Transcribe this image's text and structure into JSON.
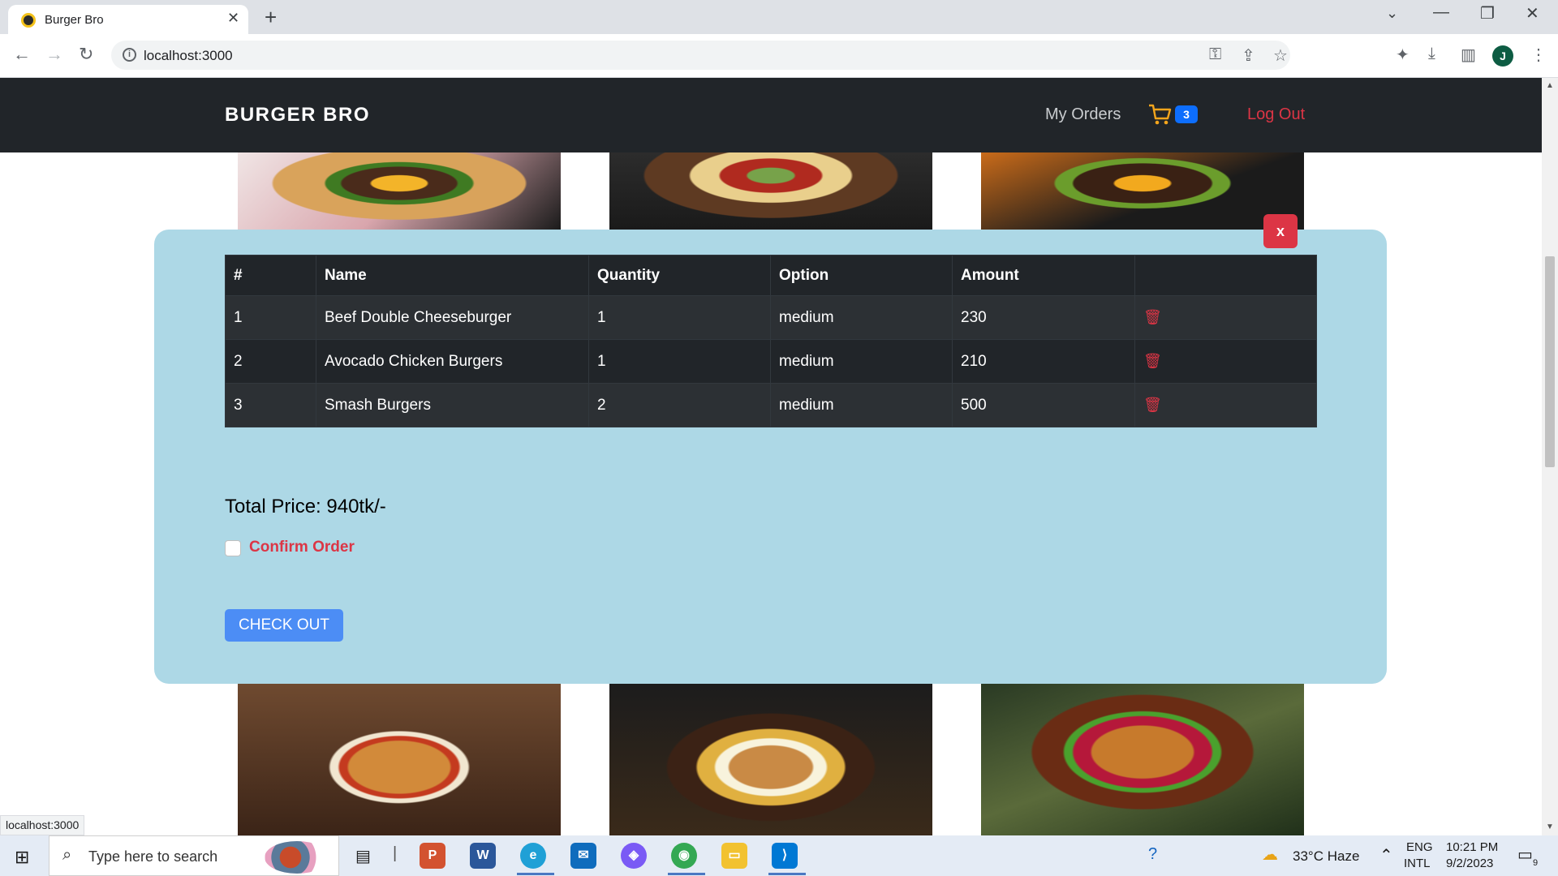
{
  "browser": {
    "tab_title": "Burger Bro",
    "tab_close": "✕",
    "new_tab": "+",
    "url": "localhost:3000",
    "profile_initial": "J",
    "status_url": "localhost:3000"
  },
  "navbar": {
    "brand": "BURGER BRO",
    "my_orders": "My Orders",
    "cart_count": "3",
    "logout": "Log Out"
  },
  "modal": {
    "close_label": "x",
    "table": {
      "headers": [
        "#",
        "Name",
        "Quantity",
        "Option",
        "Amount",
        ""
      ],
      "rows": [
        {
          "num": "1",
          "name": "Beef Double Cheeseburger",
          "quantity": "1",
          "option": "medium",
          "amount": "230"
        },
        {
          "num": "2",
          "name": "Avocado Chicken Burgers",
          "quantity": "1",
          "option": "medium",
          "amount": "210"
        },
        {
          "num": "3",
          "name": "Smash Burgers",
          "quantity": "2",
          "option": "medium",
          "amount": "500"
        }
      ]
    },
    "total_price": "Total Price: 940tk/-",
    "confirm_label": "Confirm Order",
    "checkout_label": "CHECK OUT"
  },
  "taskbar": {
    "search_placeholder": "Type here to search",
    "weather": "33°C  Haze",
    "language_top": "ENG",
    "language_bottom": "INTL",
    "time": "10:21 PM",
    "date": "9/2/2023",
    "notification_count": "9"
  },
  "colors": {
    "navbar_bg": "#212529",
    "modal_bg": "#add8e6",
    "danger": "#dc3545",
    "primary": "#0d6efd",
    "checkout_bg": "#4c8df5",
    "cart_icon": "#f4a51c"
  }
}
